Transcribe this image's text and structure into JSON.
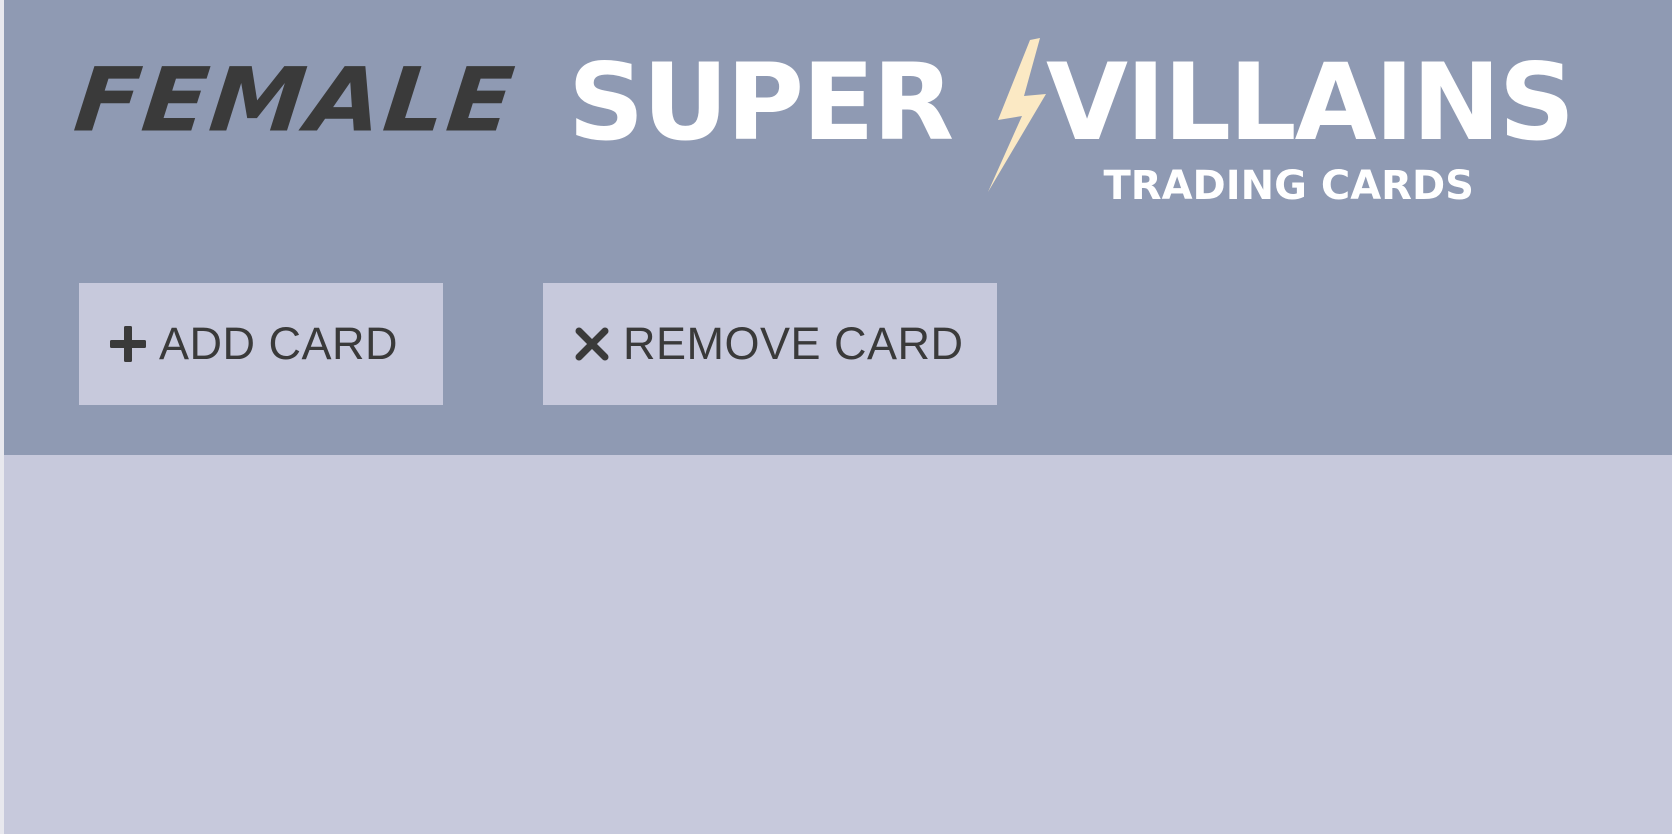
{
  "logo": {
    "word_female": "FEMALE",
    "word_super": "SUPER",
    "word_villains": "VILLAINS",
    "subtitle": "TRADING CARDS",
    "bolt_icon": "lightning-bolt-icon"
  },
  "toolbar": {
    "add_label": "ADD CARD",
    "add_icon": "plus-icon",
    "remove_label": "REMOVE CARD",
    "remove_icon": "close-icon"
  },
  "colors": {
    "header_bg": "#8f9ab3",
    "content_bg": "#c7c9dc",
    "button_bg": "#c7c9dc",
    "text_dark": "#3a3a3a",
    "bolt": "#fbe9c4"
  }
}
